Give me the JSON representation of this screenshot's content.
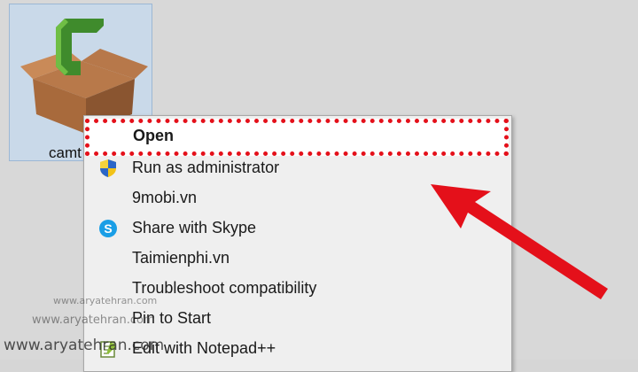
{
  "desktop_icon": {
    "label": "camt",
    "icon": "camtasia-box-icon"
  },
  "context_menu": {
    "items": [
      {
        "label": "Open",
        "icon": ""
      },
      {
        "label": "Run as administrator",
        "icon": "uac-shield-icon"
      },
      {
        "label": "9mobi.vn",
        "icon": ""
      },
      {
        "label": "Share with Skype",
        "icon": "skype-icon"
      },
      {
        "label": "Taimienphi.vn",
        "icon": ""
      },
      {
        "label": "Troubleshoot compatibility",
        "icon": ""
      },
      {
        "label": "Pin to Start",
        "icon": ""
      },
      {
        "label": "Edit with Notepad++",
        "icon": "notepad-plus-plus-icon"
      }
    ]
  },
  "annotations": {
    "highlight_color": "#e4101a",
    "arrow_color": "#e4101a"
  },
  "watermarks": {
    "small": "www.aryatehran.com",
    "medium": "www.aryatehran.com",
    "large": "www.aryatehran.com"
  }
}
